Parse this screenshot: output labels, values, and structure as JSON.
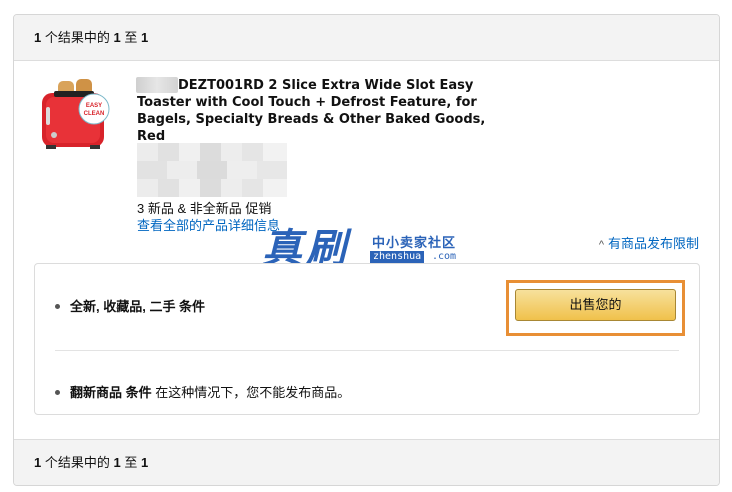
{
  "results_header": {
    "count": "1",
    "text_of": "个结果中的",
    "from": "1",
    "text_to": "至",
    "to": "1"
  },
  "results_footer": {
    "count": "1",
    "text_of": "个结果中的",
    "from": "1",
    "text_to": "至",
    "to": "1"
  },
  "product": {
    "title": "DEZT001RD 2 Slice Extra Wide Slot Easy Toaster with Cool Touch + Defrost Feature, for Bagels, Specialty Breads & Other Baked Goods, Red",
    "offers": "3 新品 & 非全新品 促销",
    "details_link": "查看全部的产品详细信息",
    "image_badge_line1": "EASY",
    "image_badge_line2": "CLEAN"
  },
  "restriction": {
    "label": "有商品发布限制",
    "icon": "chevron-up-icon"
  },
  "watermark": {
    "big": "真刷",
    "cn": "中小卖家社区",
    "site": "zhenshua",
    "com": ".com"
  },
  "conditions": {
    "row1_label": "全新, 收藏品, 二手 条件",
    "sell_button": "出售您的",
    "row2_label": "翻新商品 条件",
    "row2_text": "在这种情况下，您不能发布商品。"
  },
  "colors": {
    "link": "#0066c0",
    "button_border_highlight": "#e88f35",
    "button_fill": "#f0c14b",
    "bar_bg": "#f3f3f3"
  }
}
